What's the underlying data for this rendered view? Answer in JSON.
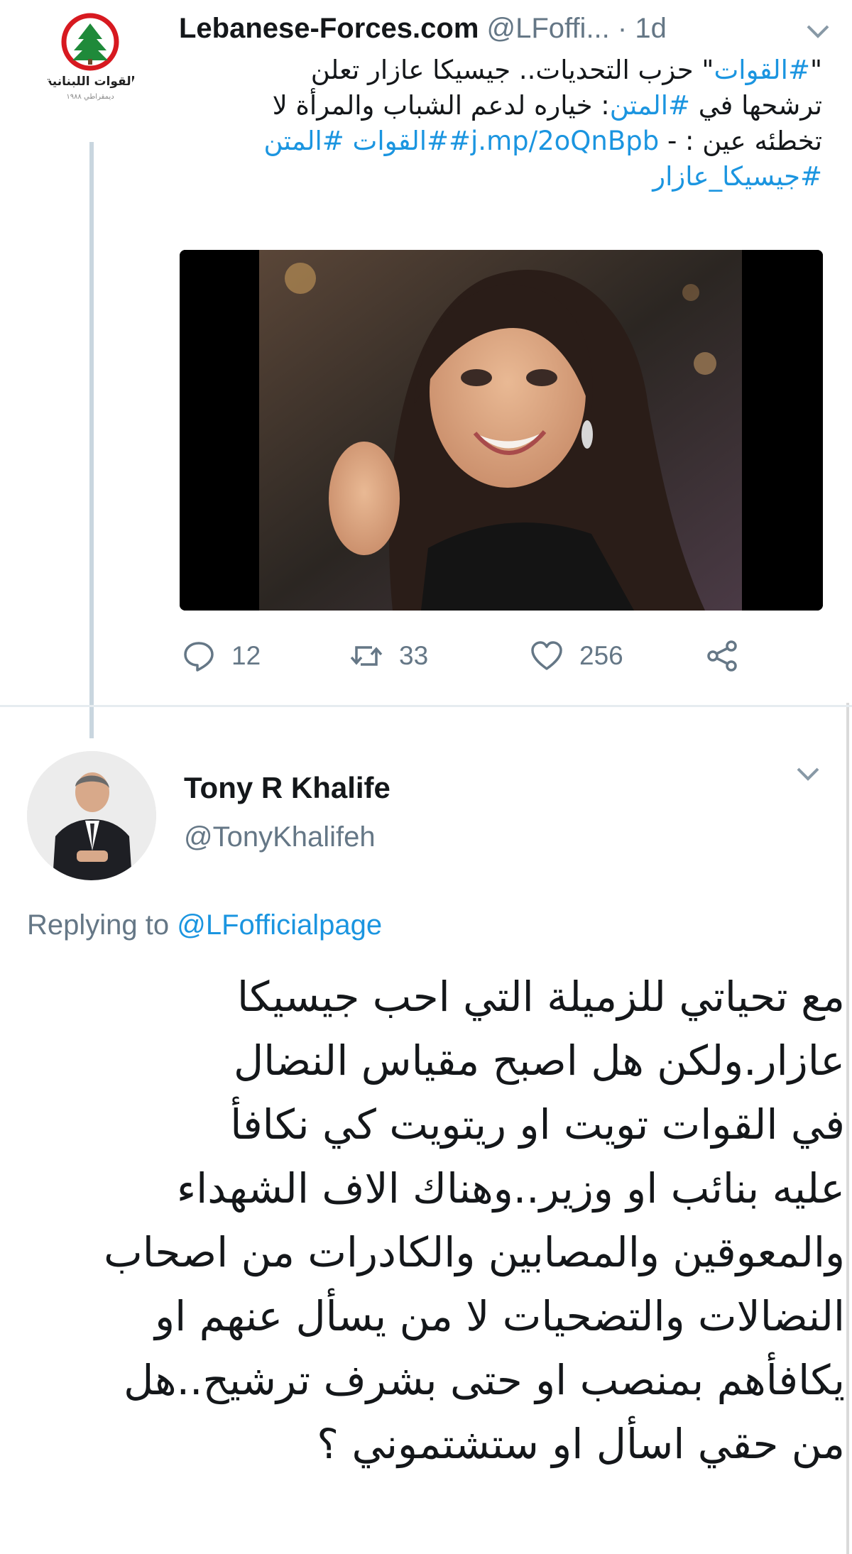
{
  "tweet1": {
    "display_name": "Lebanese-Forces.com",
    "handle": "@LFoffi...",
    "time": "· 1d",
    "logo_text": "القوات اللبنانية",
    "logo_subtext": "ديمقراطي ١٩٨٨",
    "body_lines": [
      {
        "parts": [
          {
            "text": "\"",
            "link": false
          },
          {
            "text": "#القوات",
            "link": true
          },
          {
            "text": "\" حزب التحديات.. جيسيكا عازار تعلن",
            "link": false
          }
        ]
      },
      {
        "parts": [
          {
            "text": "ترشحها في ",
            "link": false
          },
          {
            "text": "#المتن",
            "link": true
          },
          {
            "text": ": خياره لدعم الشباب والمرأة لا",
            "link": false
          }
        ]
      },
      {
        "parts": [
          {
            "text": "تخطئه عين : - ",
            "link": false
          },
          {
            "text": "j.mp/2oQnBpb",
            "link": true
          },
          {
            "text": "#",
            "link": true
          },
          {
            "text": "#القوات #المتن",
            "link": true
          }
        ]
      },
      {
        "parts": [
          {
            "text": "#جيسيكا_عازار",
            "link": true
          }
        ]
      }
    ],
    "actions": {
      "reply_count": "12",
      "retweet_count": "33",
      "like_count": "256"
    }
  },
  "tweet2": {
    "display_name": "Tony R Khalife",
    "handle": "@TonyKhalifeh",
    "replying_prefix": "Replying to ",
    "replying_to": "@LFofficialpage",
    "body_lines": [
      "مع تحياتي للزميلة التي احب جيسيكا",
      "عازار.ولكن هل اصبح مقياس النضال",
      "في القوات تويت او ريتويت كي نكافأ",
      "عليه بنائب او وزير..وهناك الاف الشهداء",
      "والمعوقين والمصابين والكادرات من اصحاب",
      "النضالات والتضحيات لا من يسأل عنهم او",
      "يكافأهم بمنصب او حتى بشرف ترشيح..هل",
      "من حقي اسأل او ستشتموني ؟"
    ]
  },
  "colors": {
    "link": "#1b95e0",
    "secondary_text": "#657786",
    "logo_red": "#d71920",
    "logo_green": "#1f8a3a"
  },
  "icons": [
    "reply-icon",
    "retweet-icon",
    "like-icon",
    "share-icon",
    "chevron-down-icon"
  ]
}
